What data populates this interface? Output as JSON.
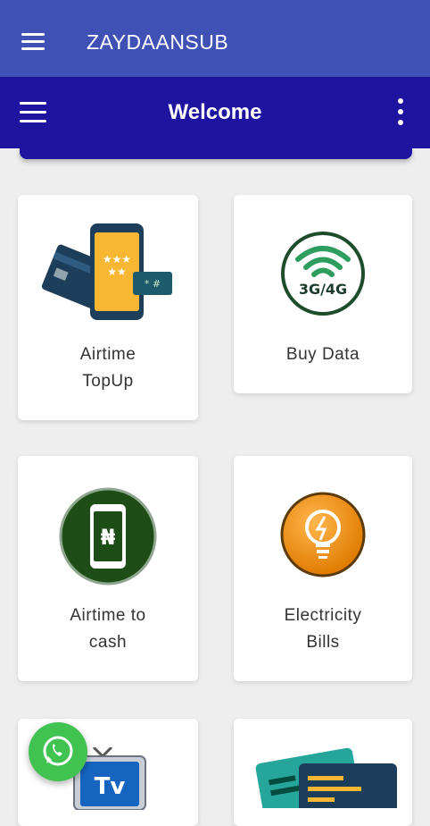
{
  "app": {
    "title": "ZAYDAANSUB"
  },
  "header": {
    "title": "Welcome"
  },
  "cards": [
    {
      "label": "Airtime\nTopUp"
    },
    {
      "label": "Buy Data",
      "badge": "3G/4G"
    },
    {
      "label": "Airtime to\ncash",
      "symbol": "₦"
    },
    {
      "label": "Electricity\nBills"
    },
    {
      "label": "",
      "symbol": "Tv"
    },
    {
      "label": ""
    }
  ],
  "colors": {
    "appbar": "#3f51b5",
    "header": "#1e14a0",
    "whatsapp": "#41c352"
  },
  "icons": [
    "menu-icon",
    "more-vert-icon",
    "whatsapp-icon"
  ]
}
